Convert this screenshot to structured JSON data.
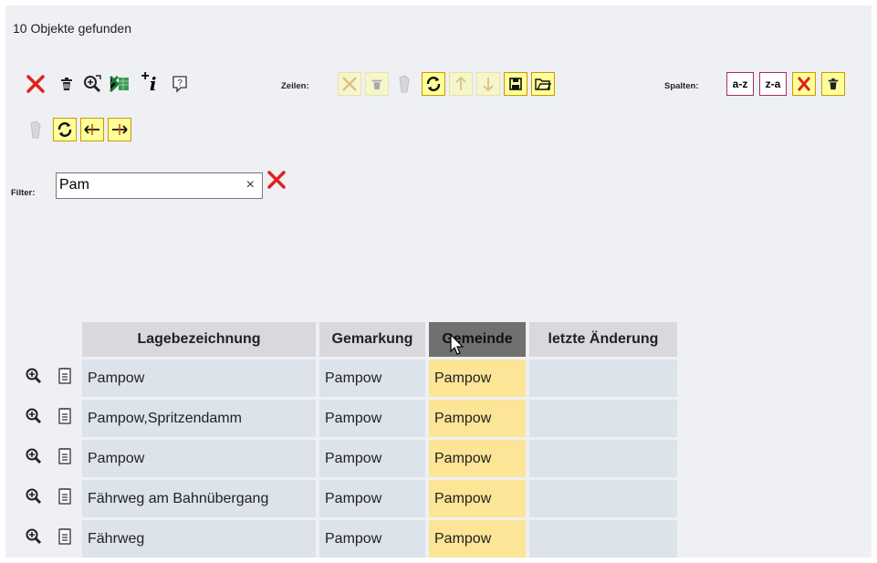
{
  "result_count": "10 Objekte gefunden",
  "toolbar": {
    "zeilen_label": "Zeilen:",
    "spalten_label": "Spalten:",
    "sort_az": "a-z",
    "sort_za": "z-a",
    "info_label": "i"
  },
  "filter": {
    "label": "Filter:",
    "value": "Pam",
    "clear_symbol": "×"
  },
  "table": {
    "headers": [
      "Lagebezeichnung",
      "Gemarkung",
      "Gemeinde",
      "letzte Änderung"
    ],
    "rows": [
      {
        "lage": "Pampow",
        "gemarkung": "Pampow",
        "gemeinde": "Pampow",
        "aenderung": ""
      },
      {
        "lage": "Pampow,Spritzendamm",
        "gemarkung": "Pampow",
        "gemeinde": "Pampow",
        "aenderung": ""
      },
      {
        "lage": "Pampow",
        "gemarkung": "Pampow",
        "gemeinde": "Pampow",
        "aenderung": ""
      },
      {
        "lage": "Fährweg am Bahnübergang",
        "gemarkung": "Pampow",
        "gemeinde": "Pampow",
        "aenderung": ""
      },
      {
        "lage": "Fährweg",
        "gemarkung": "Pampow",
        "gemeinde": "Pampow",
        "aenderung": ""
      }
    ]
  },
  "colors": {
    "panel_bg": "#eef0f3",
    "header_bg": "#d7d9dc",
    "header_active_bg": "#707070",
    "highlight_col": "#fce596",
    "cell_bg": "#dde3ea",
    "delete_red": "#e02020"
  },
  "icons": [
    "delete-x-icon",
    "trash-icon",
    "zoom-selection-icon",
    "excel-export-icon",
    "add-info-icon",
    "help-icon",
    "rows-delete-icon",
    "rows-trash-icon",
    "rows-redo-icon",
    "rows-refresh-icon",
    "rows-up-icon",
    "rows-down-icon",
    "rows-save-icon",
    "rows-open-icon",
    "columns-delete-icon",
    "columns-trash-icon",
    "columns-redo-icon",
    "columns-refresh-icon",
    "columns-move-left-icon",
    "columns-move-right-icon",
    "zoom-icon",
    "document-icon"
  ]
}
